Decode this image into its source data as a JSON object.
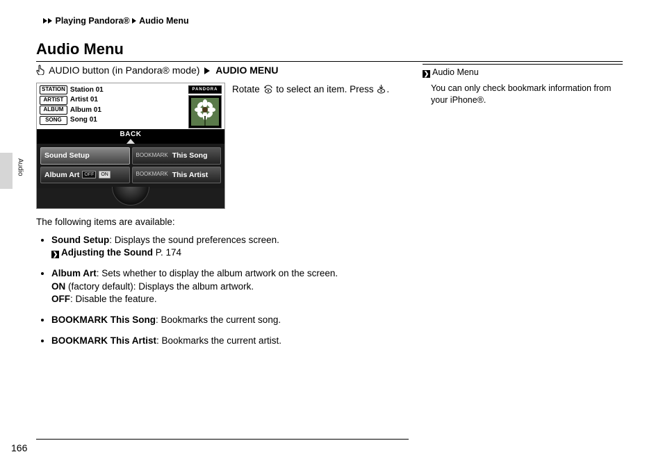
{
  "breadcrumb": {
    "a": "Playing Pandora®",
    "b": "Audio Menu"
  },
  "heading": "Audio Menu",
  "step": {
    "prefix": "AUDIO button (in Pandora® mode)",
    "target": "AUDIO MENU"
  },
  "rotate_line": {
    "a": "Rotate ",
    "b": " to select an item. Press ",
    "c": "."
  },
  "device": {
    "rows": [
      {
        "tag": "STATION",
        "val": "Station 01"
      },
      {
        "tag": "ARTIST",
        "val": "Artist 01"
      },
      {
        "tag": "ALBUM",
        "val": "Album 01"
      },
      {
        "tag": "SONG",
        "val": "Song 01"
      }
    ],
    "brand": "PANDORA",
    "back": "BACK",
    "menu": {
      "sound_setup": "Sound Setup",
      "album_art": "Album Art",
      "off": "OFF",
      "on": "ON",
      "bookmark_label": "BOOKMARK",
      "this_song": "This Song",
      "this_artist": "This Artist"
    }
  },
  "intro": "The following items are available:",
  "items": {
    "sound_setup": {
      "name": "Sound Setup",
      "desc": ": Displays the sound preferences screen.",
      "xref": "Adjusting the Sound",
      "xref_page": "P. 174"
    },
    "album_art": {
      "name": "Album Art",
      "desc": ": Sets whether to display the album artwork on the screen.",
      "on_label": "ON",
      "on_desc": " (factory default): Displays the album artwork.",
      "off_label": "OFF",
      "off_desc": ": Disable the feature."
    },
    "bm_song": {
      "name": "BOOKMARK This Song",
      "desc": ": Bookmarks the current song."
    },
    "bm_artist": {
      "name": "BOOKMARK This Artist",
      "desc": ": Bookmarks the current artist."
    }
  },
  "sidebar": {
    "head": "Audio Menu",
    "body": "You can only check bookmark information from your iPhone®."
  },
  "tab_label": "Audio",
  "page_number": "166"
}
